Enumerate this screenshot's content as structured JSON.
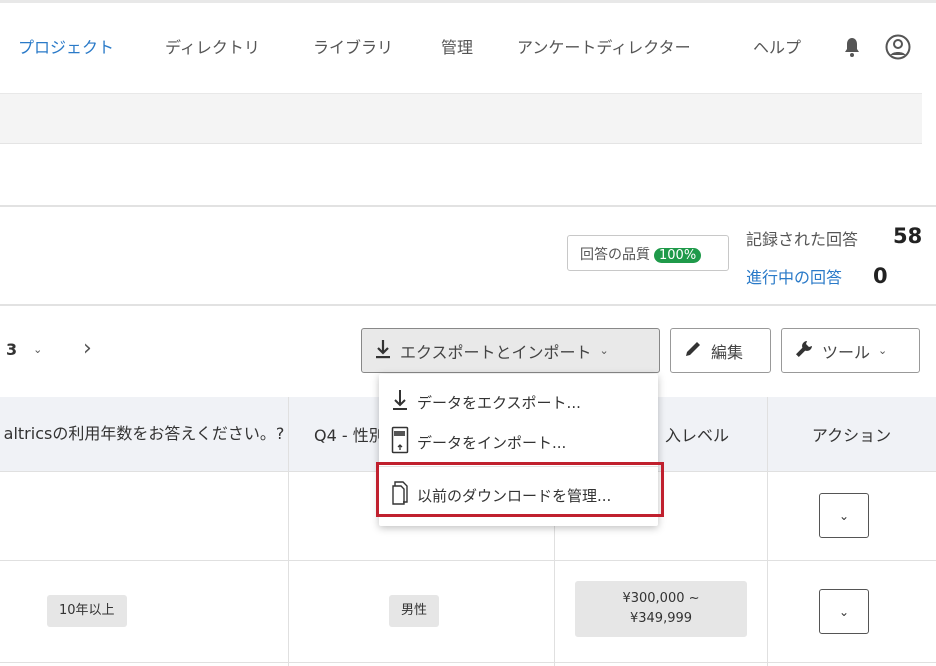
{
  "nav": {
    "items": [
      "プロジェクト",
      "ディレクトリ",
      "ライブラリ",
      "管理",
      "アンケートディレクター",
      "ヘルプ"
    ],
    "active": "プロジェクト"
  },
  "stats": {
    "quality_label": "回答の品質",
    "quality_value": "100%",
    "recorded_label": "記録された回答",
    "recorded_value": "58",
    "inprogress_label": "進行中の回答",
    "inprogress_value": "0"
  },
  "toolbar": {
    "page_value": "3",
    "export_import_label": "エクスポートとインポート",
    "edit_label": "編集",
    "tools_label": "ツール"
  },
  "menu": {
    "items": [
      "データをエクスポート...",
      "データをインポート...",
      "以前のダウンロードを管理..."
    ]
  },
  "table": {
    "headers": [
      "altricsの利用年数をお答えください。?",
      "Q4 - 性別",
      "入レベル",
      "アクション"
    ],
    "rows": [
      {
        "years": "",
        "gender": "",
        "income": ""
      },
      {
        "years": "10年以上",
        "gender": "男性",
        "income": "¥300,000 ~ ¥349,999"
      }
    ]
  },
  "colors": {
    "accent": "#2a7ac8",
    "badge": "#1f9a4a",
    "highlight": "#c0202e"
  }
}
